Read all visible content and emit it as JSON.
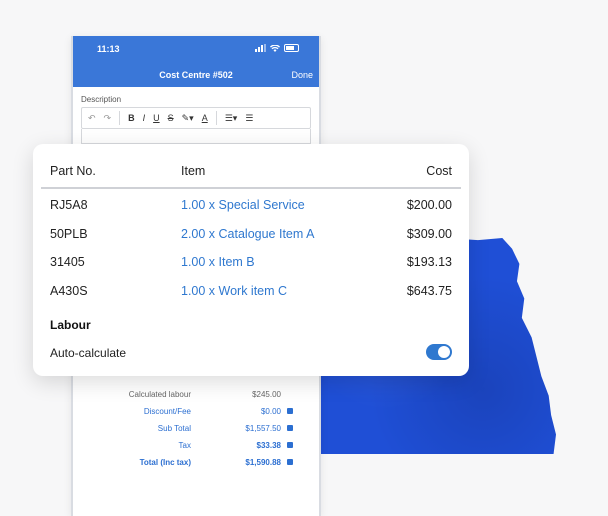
{
  "phone": {
    "status_time": "11:13",
    "nav_title": "Cost Centre #502",
    "nav_done": "Done",
    "description_label": "Description"
  },
  "toolbar": {
    "undo": "↶",
    "redo": "↷",
    "bold": "B",
    "italic": "I",
    "underline": "U",
    "strike": "S",
    "text_color": "A"
  },
  "table": {
    "headers": {
      "part_no": "Part No.",
      "item": "Item",
      "cost": "Cost"
    },
    "rows": [
      {
        "part_no": "RJ5A8",
        "item": "1.00 x Special Service",
        "cost": "$200.00"
      },
      {
        "part_no": "50PLB",
        "item": "2.00 x Catalogue Item A",
        "cost": "$309.00"
      },
      {
        "part_no": "31405",
        "item": "1.00 x Item B",
        "cost": "$193.13"
      },
      {
        "part_no": "A430S",
        "item": "1.00 x Work item C",
        "cost": "$643.75"
      }
    ]
  },
  "labour": {
    "heading": "Labour",
    "auto_calculate_label": "Auto-calculate",
    "auto_calculate_on": true
  },
  "summary": {
    "calculated_labour_label": "Calculated labour",
    "calculated_labour_value": "$245.00",
    "discount_label": "Discount/Fee",
    "discount_value": "$0.00",
    "subtotal_label": "Sub Total",
    "subtotal_value": "$1,557.50",
    "tax_label": "Tax",
    "tax_value": "$33.38",
    "total_label": "Total (Inc tax)",
    "total_value": "$1,590.88"
  },
  "colors": {
    "brand": "#3a77d8",
    "link": "#2f78cf",
    "paper": "#1f4fd6"
  }
}
